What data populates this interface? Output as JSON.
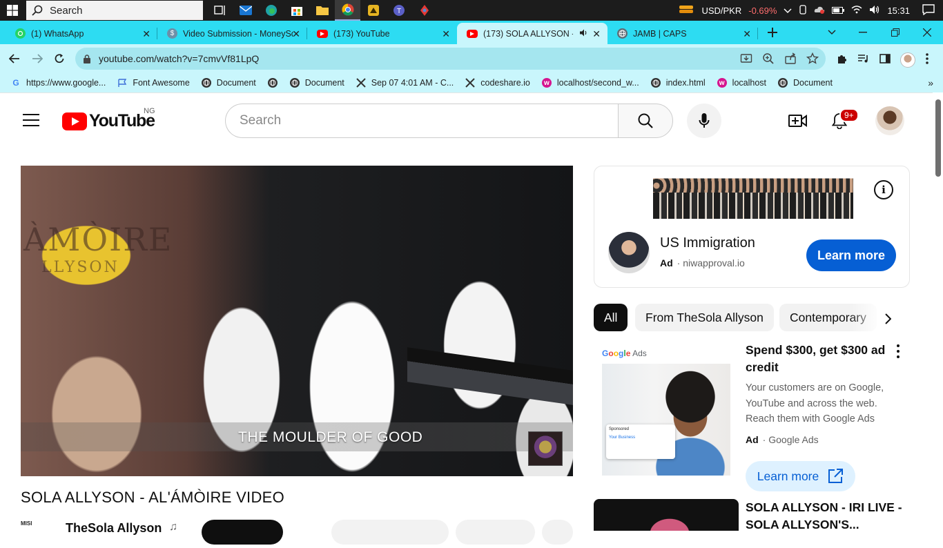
{
  "taskbar": {
    "search_label": "Search",
    "currency_pair": "USD/PKR",
    "currency_change": "-0.69%",
    "time": "15:31",
    "apps": [
      "task-view",
      "mail",
      "edge",
      "store",
      "file-explorer",
      "chrome",
      "app-yellow",
      "teams",
      "app-red"
    ]
  },
  "tabs": [
    {
      "title": "(1) WhatsApp",
      "icon": "whatsapp-icon"
    },
    {
      "title": "Video Submission - MoneySc",
      "icon": "dollar-icon"
    },
    {
      "title": "(173) YouTube",
      "icon": "youtube-icon"
    },
    {
      "title": "(173) SOLA ALLYSON - A",
      "icon": "youtube-icon"
    },
    {
      "title": "JAMB | CAPS",
      "icon": "globe-icon"
    }
  ],
  "browser": {
    "url": "youtube.com/watch?v=7cmvVf81LpQ"
  },
  "bookmarks": [
    {
      "label": "https://www.google...",
      "icon": "google-icon"
    },
    {
      "label": "Font Awesome",
      "icon": "flag-icon"
    },
    {
      "label": "Document",
      "icon": "globe-icon"
    },
    {
      "label": "",
      "icon": "globe-icon"
    },
    {
      "label": "Document",
      "icon": "globe-icon"
    },
    {
      "label": "Sep 07 4:01 AM - C...",
      "icon": "codeshare-icon"
    },
    {
      "label": "codeshare.io",
      "icon": "codeshare-icon"
    },
    {
      "label": "localhost/second_w...",
      "icon": "wamp-icon"
    },
    {
      "label": "index.html",
      "icon": "globe-icon"
    },
    {
      "label": "localhost",
      "icon": "wamp-icon"
    },
    {
      "label": "Document",
      "icon": "globe-icon"
    }
  ],
  "youtube": {
    "logo_text": "YouTube",
    "country_code": "NG",
    "search_placeholder": "Search",
    "notification_count": "9+"
  },
  "video": {
    "backdrop_text_1": "ÀMÒIRE",
    "backdrop_text_2": "LLYSON",
    "caption": "THE MOULDER OF GOOD",
    "title": "SOLA ALLYSON - AL'ÁMÒIRE VIDEO",
    "channel_name": "TheSola Allyson",
    "channel_note": "♫",
    "channel_avatar_text": "MISI"
  },
  "ad": {
    "title": "US Immigration",
    "ad_label": "Ad",
    "domain": "niwapproval.io",
    "cta": "Learn more",
    "info_glyph": "i"
  },
  "chips": [
    "All",
    "From TheSola Allyson",
    "Contemporary"
  ],
  "recommendations": [
    {
      "brand_parts": [
        "G",
        "o",
        "o",
        "g",
        "l",
        "e"
      ],
      "brand_suffix": " Ads",
      "card_label": "Sponsored",
      "card_sub": "Your Business",
      "title": "Spend $300, get $300 ad credit",
      "description": "Your customers are on Google, YouTube and across the web. Reach them with Google Ads",
      "ad_label": "Ad",
      "advertiser": "Google Ads",
      "cta": "Learn more"
    },
    {
      "title": "SOLA ALLYSON - IRI LIVE - SOLA ALLYSON'S..."
    }
  ],
  "colors": {
    "tabstrip": "#2ddcf2",
    "toolbar": "#c9f6fc",
    "yt_red": "#ff0000",
    "cta_blue": "#065fd4"
  }
}
